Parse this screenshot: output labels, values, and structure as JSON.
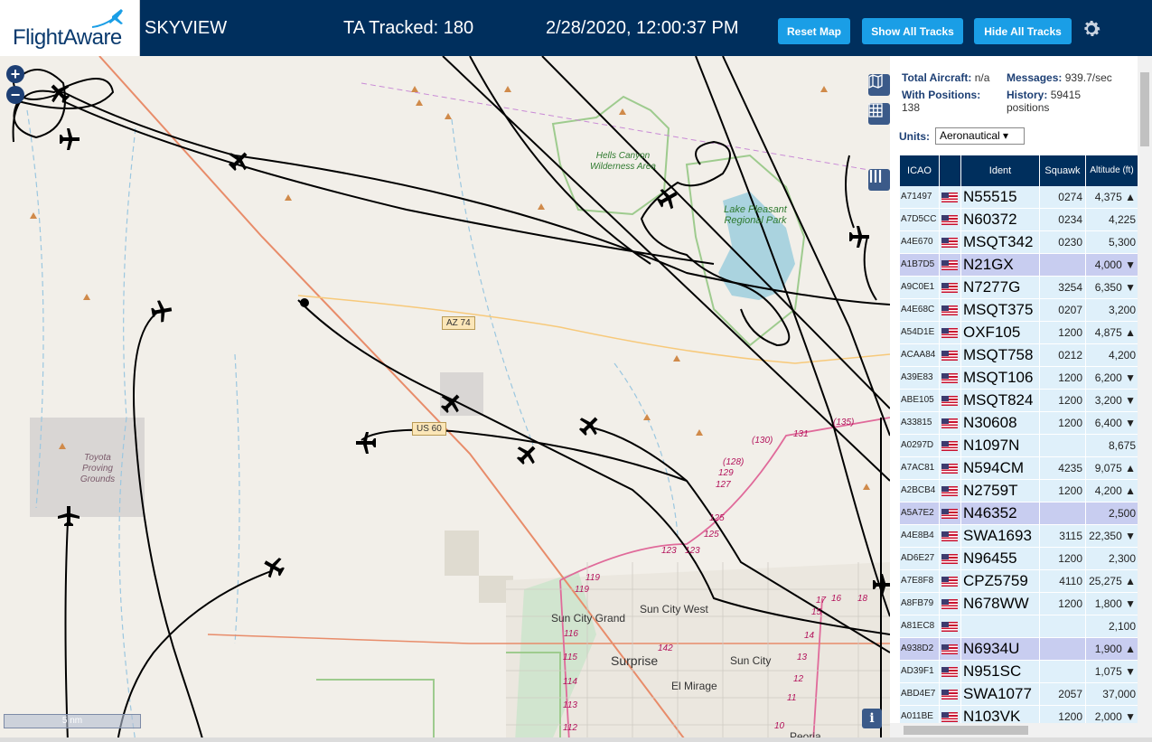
{
  "header": {
    "brand": "FlightAware",
    "app_title": "SKYVIEW",
    "tracked": "TA Tracked: 180",
    "datetime": "2/28/2020, 12:00:37 PM",
    "reset_map": "Reset Map",
    "show_tracks": "Show All Tracks",
    "hide_tracks": "Hide All Tracks"
  },
  "map": {
    "zoom_in": "+",
    "zoom_out": "−",
    "scale": "5 nm",
    "labels": {
      "az74": "AZ 74",
      "us60": "US 60",
      "hells_canyon": "Hells Canyon Wilderness Area",
      "lake_pleasant": "Lake Pleasant Regional Park",
      "toyota": "Toyota Proving Grounds",
      "sun_city_grand": "Sun City Grand",
      "sun_city_west": "Sun City West",
      "surprise": "Surprise",
      "sun_city": "Sun City",
      "el_mirage": "El Mirage",
      "peoria": "Peoria"
    },
    "routes": {
      "r130": "(130)",
      "r131": "131",
      "r135": "(135)",
      "r128": "(128)",
      "r129": "129",
      "r127": "127",
      "r125": "125",
      "r125b": "125",
      "r123": "123",
      "r123b": "123",
      "r119": "119",
      "r119b": "119",
      "r116": "116",
      "r115": "115",
      "r114": "114",
      "r113": "113",
      "r112": "112",
      "r142": "142",
      "r17": "17",
      "r16": "16",
      "r18": "18",
      "r15": "15",
      "r14": "14",
      "r13": "13",
      "r12": "12",
      "r11": "11",
      "r10": "10"
    }
  },
  "stats": {
    "total_aircraft_label": "Total Aircraft:",
    "total_aircraft_value": "n/a",
    "messages_label": "Messages:",
    "messages_value": "939.7/sec",
    "with_positions_label": "With Positions:",
    "with_positions_value": "138",
    "history_label": "History:",
    "history_value": "59415 positions"
  },
  "units": {
    "label": "Units:",
    "selected": "Aeronautical ▾"
  },
  "table": {
    "headers": {
      "icao": "ICAO",
      "ident": "Ident",
      "squawk": "Squawk",
      "altitude": "Altitude (ft)"
    },
    "rows": [
      {
        "icao": "A71497",
        "ident": "N55515",
        "squawk": "0274",
        "alt": "4,375 ▲"
      },
      {
        "icao": "A7D5CC",
        "ident": "N60372",
        "squawk": "0234",
        "alt": "4,225"
      },
      {
        "icao": "A4E670",
        "ident": "MSQT342",
        "squawk": "0230",
        "alt": "5,300"
      },
      {
        "icao": "A1B7D5",
        "ident": "N21GX",
        "squawk": "",
        "alt": "4,000 ▼"
      },
      {
        "icao": "A9C0E1",
        "ident": "N7277G",
        "squawk": "3254",
        "alt": "6,350 ▼"
      },
      {
        "icao": "A4E68C",
        "ident": "MSQT375",
        "squawk": "0207",
        "alt": "3,200"
      },
      {
        "icao": "A54D1E",
        "ident": "OXF105",
        "squawk": "1200",
        "alt": "4,875 ▲"
      },
      {
        "icao": "ACAA84",
        "ident": "MSQT758",
        "squawk": "0212",
        "alt": "4,200"
      },
      {
        "icao": "A39E83",
        "ident": "MSQT106",
        "squawk": "1200",
        "alt": "6,200 ▼"
      },
      {
        "icao": "ABE105",
        "ident": "MSQT824",
        "squawk": "1200",
        "alt": "3,200 ▼"
      },
      {
        "icao": "A33815",
        "ident": "N30608",
        "squawk": "1200",
        "alt": "6,400 ▼"
      },
      {
        "icao": "A0297D",
        "ident": "N1097N",
        "squawk": "",
        "alt": "8,675"
      },
      {
        "icao": "A7AC81",
        "ident": "N594CM",
        "squawk": "4235",
        "alt": "9,075 ▲"
      },
      {
        "icao": "A2BCB4",
        "ident": "N2759T",
        "squawk": "1200",
        "alt": "4,200 ▲"
      },
      {
        "icao": "A5A7E2",
        "ident": "N46352",
        "squawk": "",
        "alt": "2,500"
      },
      {
        "icao": "A4E8B4",
        "ident": "SWA1693",
        "squawk": "3115",
        "alt": "22,350 ▼"
      },
      {
        "icao": "AD6E27",
        "ident": "N96455",
        "squawk": "1200",
        "alt": "2,300"
      },
      {
        "icao": "A7E8F8",
        "ident": "CPZ5759",
        "squawk": "4110",
        "alt": "25,275 ▲"
      },
      {
        "icao": "A8FB79",
        "ident": "N678WW",
        "squawk": "1200",
        "alt": "1,800 ▼"
      },
      {
        "icao": "A81EC8",
        "ident": "",
        "squawk": "",
        "alt": "2,100"
      },
      {
        "icao": "A938D2",
        "ident": "N6934U",
        "squawk": "",
        "alt": "1,900 ▲"
      },
      {
        "icao": "AD39F1",
        "ident": "N951SC",
        "squawk": "",
        "alt": "1,075 ▼"
      },
      {
        "icao": "ABD4E7",
        "ident": "SWA1077",
        "squawk": "2057",
        "alt": "37,000"
      },
      {
        "icao": "A011BE",
        "ident": "N103VK",
        "squawk": "1200",
        "alt": "2,000 ▼"
      }
    ],
    "selected_rows": [
      3,
      14,
      20
    ]
  },
  "colors": {
    "header_bg": "#002f5d",
    "button_bg": "#1a9ee6",
    "row_bg": "#dff0fa",
    "row_selected_bg": "#c8cdf0",
    "track": "#000000"
  },
  "icons": [
    "plane-logo-icon",
    "gear-icon",
    "zoom-in-icon",
    "zoom-out-icon",
    "map-layers-icon",
    "grid-icon",
    "columns-icon",
    "info-icon",
    "us-flag-icon",
    "aircraft-icon"
  ]
}
